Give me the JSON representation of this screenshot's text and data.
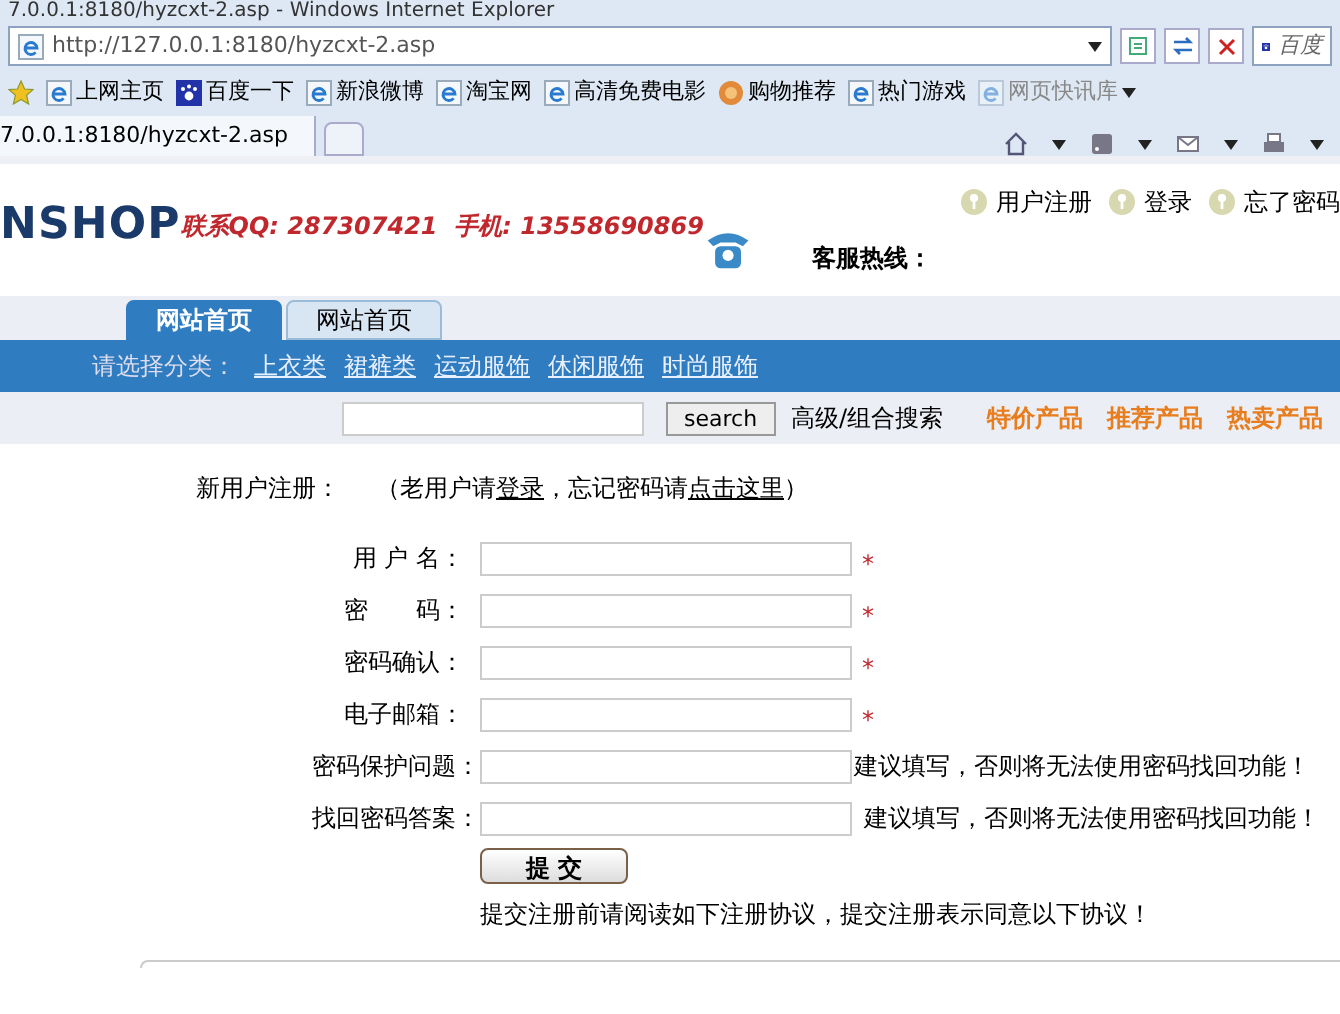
{
  "window": {
    "title": "7.0.0.1:8180/hyzcxt-2.asp - Windows Internet Explorer"
  },
  "address_bar": {
    "url": "http://127.0.0.1:8180/hyzcxt-2.asp",
    "search_label": "百度"
  },
  "favorites": [
    {
      "label": "上网主页",
      "kind": "ie"
    },
    {
      "label": "百度一下",
      "kind": "paw"
    },
    {
      "label": "新浪微博",
      "kind": "ie"
    },
    {
      "label": "淘宝网",
      "kind": "ie"
    },
    {
      "label": "高清免费电影",
      "kind": "ie"
    },
    {
      "label": "购物推荐",
      "kind": "coin"
    },
    {
      "label": "热门游戏",
      "kind": "ie"
    },
    {
      "label": "网页快讯库",
      "kind": "ie-dim"
    }
  ],
  "browser_tab": {
    "title": "7.0.0.1:8180/hyzcxt-2.asp"
  },
  "header": {
    "logo": "NSHOP",
    "contact": "联系QQ: 287307421  手机: 13558690869",
    "hotline": "客服热线：",
    "links": [
      "用户注册",
      "登录",
      "忘了密码"
    ]
  },
  "nav_tabs": [
    {
      "label": "网站首页",
      "selected": true
    },
    {
      "label": "网站首页",
      "selected": false
    }
  ],
  "category_bar": {
    "label": "请选择分类：",
    "items": [
      "上衣类",
      "裙裤类",
      "运动服饰",
      "休闲服饰",
      "时尚服饰"
    ]
  },
  "search": {
    "button": "search",
    "advanced": "高级/组合搜索",
    "promos": [
      "特价产品",
      "推荐产品",
      "热卖产品"
    ]
  },
  "register": {
    "title": "新用户注册：",
    "note_before": "（老用户请",
    "login_link": "登录",
    "note_middle": "，忘记密码请",
    "forgot_link": "点击这里",
    "note_after": "）",
    "fields": [
      {
        "label": "用 户 名：",
        "kind": "required",
        "mark": "*"
      },
      {
        "label": "密　　码：",
        "kind": "required",
        "mark": "*"
      },
      {
        "label": "密码确认：",
        "kind": "required",
        "mark": "*"
      },
      {
        "label": "电子邮箱：",
        "kind": "required",
        "mark": "*"
      },
      {
        "label": "密码保护问题：",
        "kind": "hint",
        "mark": "建议填写，否则将无法使用密码找回功能！"
      },
      {
        "label": "找回密码答案：",
        "kind": "hint",
        "mark": "建议填写，否则将无法使用密码找回功能！"
      }
    ],
    "submit": "提 交",
    "agreement": "提交注册前请阅读如下注册协议，提交注册表示同意以下协议！"
  }
}
